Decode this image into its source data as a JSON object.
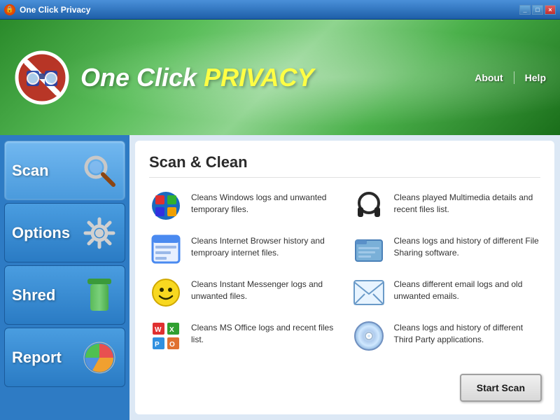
{
  "titleBar": {
    "title": "One Click Privacy",
    "controls": [
      "_",
      "□",
      "×"
    ]
  },
  "header": {
    "logoText1": "ne Click",
    "logoTextHighlight": "PRIVACY",
    "navItems": [
      {
        "label": "About",
        "id": "about"
      },
      {
        "label": "Help",
        "id": "help"
      }
    ]
  },
  "sidebar": {
    "items": [
      {
        "label": "Scan",
        "id": "scan",
        "active": true
      },
      {
        "label": "Options",
        "id": "options",
        "active": false
      },
      {
        "label": "Shred",
        "id": "shred",
        "active": false
      },
      {
        "label": "Report",
        "id": "report",
        "active": false
      }
    ]
  },
  "content": {
    "title": "Scan & Clean",
    "features": [
      {
        "id": "windows-logs",
        "icon": "windows",
        "text": "Cleans Windows logs and unwanted temporary files."
      },
      {
        "id": "multimedia",
        "icon": "headphone",
        "text": "Cleans played Multimedia details and recent files list."
      },
      {
        "id": "browser-history",
        "icon": "browser",
        "text": "Cleans Internet Browser history and temproary internet files."
      },
      {
        "id": "file-sharing",
        "icon": "fileshare",
        "text": "Cleans logs and history of different File Sharing software."
      },
      {
        "id": "messenger",
        "icon": "messenger",
        "text": "Cleans Instant Messenger logs and unwanted files."
      },
      {
        "id": "email",
        "icon": "email",
        "text": "Cleans different email logs and old unwanted emails."
      },
      {
        "id": "msoffice",
        "icon": "msoffice",
        "text": "Cleans MS Office logs and recent files list."
      },
      {
        "id": "thirdparty",
        "icon": "cd",
        "text": "Cleans logs and history of different Third Party applications."
      }
    ],
    "startScanLabel": "Start Scan"
  }
}
